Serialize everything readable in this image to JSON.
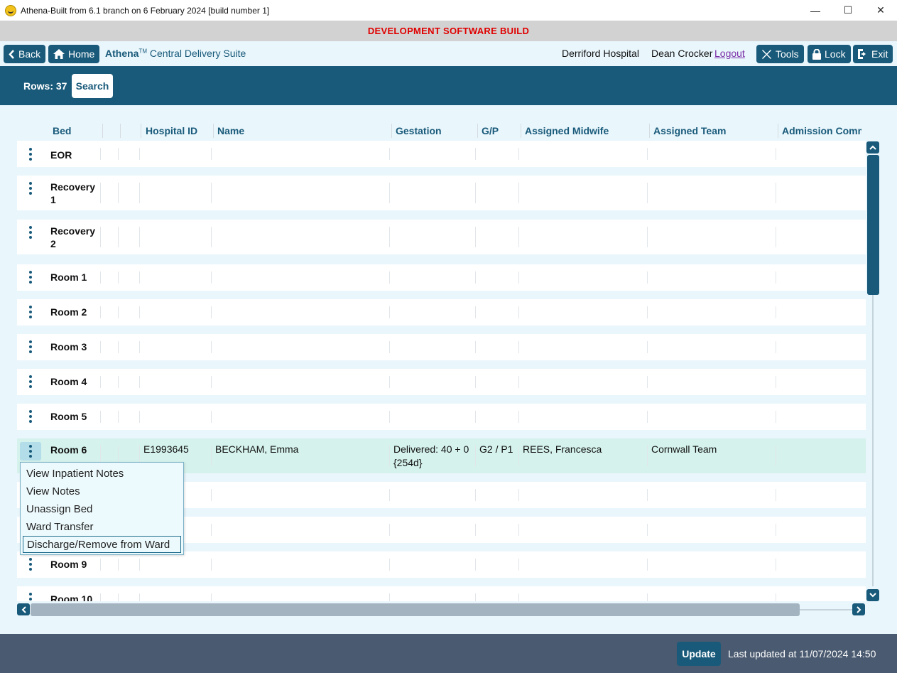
{
  "window": {
    "title": "Athena-Built from 6.1 branch on 6 February 2024 [build number 1]",
    "minimize": "—",
    "maximize": "☐",
    "close": "✕"
  },
  "banner": "DEVELOPMENT SOFTWARE BUILD",
  "nav": {
    "back_label": "Back",
    "home_label": "Home",
    "brand": "Athena",
    "brand_tm": "TM",
    "module": "Central Delivery Suite",
    "hospital": "Derriford Hospital",
    "user": "Dean Crocker",
    "logout_label": "Logout",
    "tools_label": "Tools",
    "lock_label": "Lock",
    "exit_label": "Exit"
  },
  "toolbar": {
    "rows_label": "Rows: 37",
    "search_label": "Search"
  },
  "grid": {
    "columns": [
      "Bed",
      "",
      "",
      "Hospital ID",
      "Name",
      "Gestation",
      "G/P",
      "Assigned Midwife",
      "Assigned Team",
      "Admission Comm"
    ],
    "rows": [
      {
        "bed": "EOR"
      },
      {
        "bed": "Recovery 1"
      },
      {
        "bed": "Recovery 2"
      },
      {
        "bed": "Room 1"
      },
      {
        "bed": "Room 2"
      },
      {
        "bed": "Room 3"
      },
      {
        "bed": "Room 4"
      },
      {
        "bed": "Room 5"
      },
      {
        "bed": "Room 6",
        "hospital_id": "E1993645",
        "name": "BECKHAM, Emma",
        "gestation_1": "Delivered: 40 + 0",
        "gestation_2": "{254d}",
        "gp": "G2 / P1",
        "midwife": "REES, Francesca",
        "team": "Cornwall Team"
      },
      {
        "bed": ""
      },
      {
        "bed": ""
      },
      {
        "bed": "Room 9"
      },
      {
        "bed": "Room 10"
      }
    ]
  },
  "context_menu": {
    "items": [
      "View Inpatient Notes",
      "View Notes",
      "Unassign Bed",
      "Ward Transfer",
      "Discharge/Remove from Ward"
    ]
  },
  "footer": {
    "update_label": "Update",
    "last_updated": "Last updated at 11/07/2024 14:50"
  },
  "colors": {
    "primary": "#195a7a",
    "banner_text": "#e00000",
    "selected_row": "#d5f2ec",
    "footer": "#4a5a70"
  }
}
